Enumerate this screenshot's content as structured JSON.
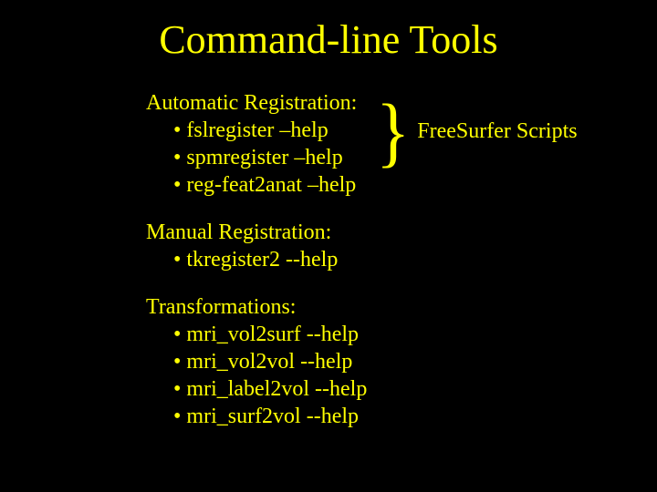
{
  "title": "Command-line Tools",
  "sections": {
    "auto": {
      "heading": "Automatic Registration:",
      "items": [
        "• fslregister –help",
        "• spmregister –help",
        "• reg-feat2anat –help"
      ]
    },
    "manual": {
      "heading": "Manual Registration:",
      "items": [
        "• tkregister2 --help"
      ]
    },
    "transform": {
      "heading": "Transformations:",
      "items": [
        "• mri_vol2surf --help",
        "• mri_vol2vol --help",
        "• mri_label2vol --help",
        "• mri_surf2vol --help"
      ]
    }
  },
  "brace_label": "FreeSurfer Scripts"
}
